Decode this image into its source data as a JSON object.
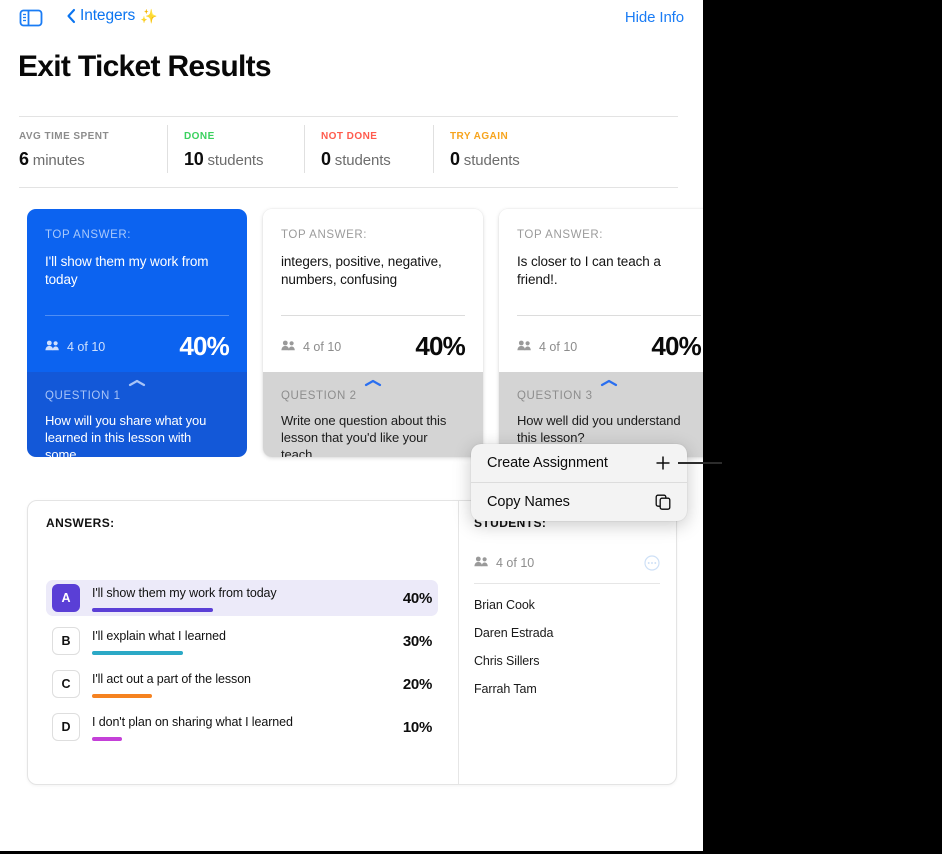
{
  "navbar": {
    "sidebar_toggle_icon": "sidebar-toggle-icon",
    "back_chevron_icon": "chevron-left-icon",
    "back_label": "Integers",
    "sparkle_icon": "✨",
    "hide_info_label": "Hide Info"
  },
  "page": {
    "title": "Exit Ticket Results"
  },
  "stats": [
    {
      "label": "AVG TIME SPENT",
      "value": "6",
      "unit": "minutes",
      "color": "#8c8c8c"
    },
    {
      "label": "DONE",
      "value": "10",
      "unit": "students",
      "color": "#3ad15e"
    },
    {
      "label": "NOT DONE",
      "value": "0",
      "unit": "students",
      "color": "#ff5b4d"
    },
    {
      "label": "TRY AGAIN",
      "value": "0",
      "unit": "students",
      "color": "#f7a41d"
    }
  ],
  "cards": [
    {
      "top_answer_label": "TOP ANSWER:",
      "top_answer": "I'll show them my work from today",
      "people_icon": "people-icon",
      "count": "4 of 10",
      "percent": "40%",
      "question_label": "QUESTION 1",
      "question": "How will you share what you learned in this lesson with some…",
      "chevron_icon": "chevron-up-icon",
      "selected": true
    },
    {
      "top_answer_label": "TOP ANSWER:",
      "top_answer": "integers, positive, negative, numbers, confusing",
      "people_icon": "people-icon",
      "count": "4 of 10",
      "percent": "40%",
      "question_label": "QUESTION 2",
      "question": "Write one question about this lesson that you'd like your teach…",
      "chevron_icon": "chevron-up-icon",
      "selected": false
    },
    {
      "top_answer_label": "TOP ANSWER:",
      "top_answer": "Is closer to I can teach a friend!.",
      "people_icon": "people-icon",
      "count": "4 of 10",
      "percent": "40%",
      "question_label": "QUESTION 3",
      "question": "How well did you understand this lesson?",
      "chevron_icon": "chevron-up-icon",
      "selected": false
    }
  ],
  "detail": {
    "answers_heading": "ANSWERS:",
    "students_heading": "STUDENTS:",
    "students_people_icon": "people-icon",
    "students_count": "4 of 10",
    "students_more_icon": "more-circle-icon",
    "answers": [
      {
        "letter": "A",
        "text": "I'll show them my work from today",
        "percent": "40%",
        "value": 40,
        "color": "#5b3fd6",
        "selected": true
      },
      {
        "letter": "B",
        "text": "I'll explain what I learned",
        "percent": "30%",
        "value": 30,
        "color": "#2ba9c6",
        "selected": false
      },
      {
        "letter": "C",
        "text": "I'll act out a part of the lesson",
        "percent": "20%",
        "value": 20,
        "color": "#f58220",
        "selected": false
      },
      {
        "letter": "D",
        "text": "I don't plan on sharing what I learned",
        "percent": "10%",
        "value": 10,
        "color": "#c440d8",
        "selected": false
      }
    ],
    "students": [
      "Brian Cook",
      "Daren Estrada",
      "Chris Sillers",
      "Farrah Tam"
    ]
  },
  "context_menu": {
    "items": [
      {
        "label": "Create Assignment",
        "icon": "plus-icon"
      },
      {
        "label": "Copy Names",
        "icon": "copy-icon"
      }
    ]
  },
  "chart_data": {
    "type": "bar",
    "title": "ANSWERS:",
    "categories": [
      "A",
      "B",
      "C",
      "D"
    ],
    "labels": [
      "I'll show them my work from today",
      "I'll explain what I learned",
      "I'll act out a part of the lesson",
      "I don't plan on sharing what I learned"
    ],
    "values": [
      40,
      30,
      20,
      10
    ],
    "value_labels": [
      "40%",
      "30%",
      "20%",
      "10%"
    ],
    "colors": [
      "#5b3fd6",
      "#2ba9c6",
      "#f58220",
      "#c440d8"
    ],
    "xlabel": "",
    "ylabel": "",
    "ylim": [
      0,
      100
    ],
    "grid": false,
    "legend": false
  }
}
